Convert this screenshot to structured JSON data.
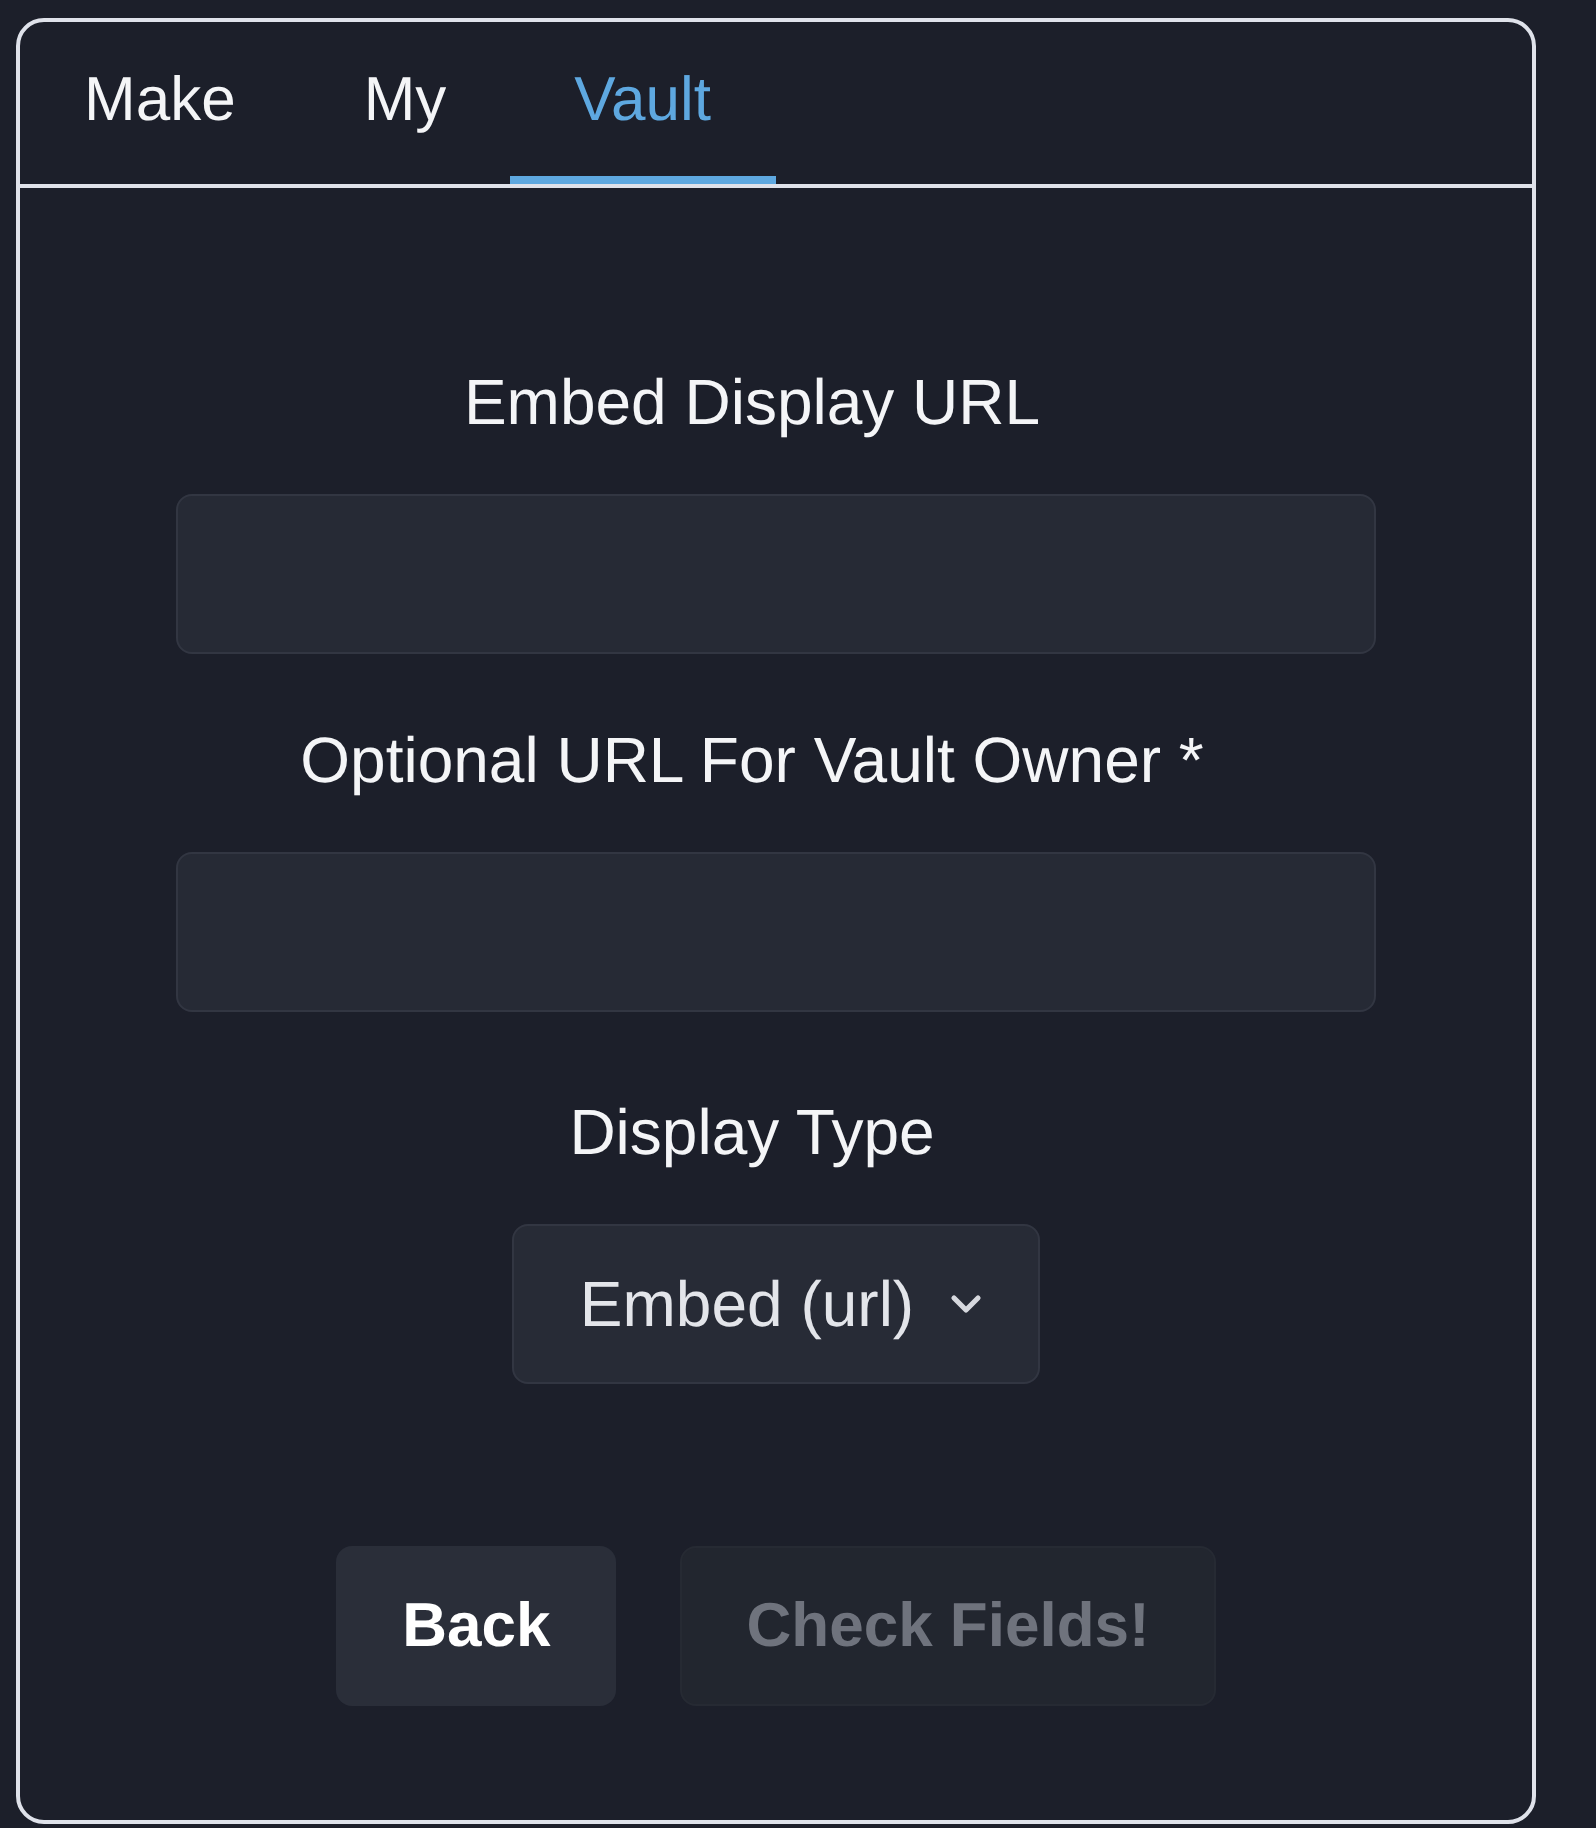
{
  "tabs": [
    {
      "label": "Make",
      "selected": false
    },
    {
      "label": "My",
      "selected": false
    },
    {
      "label": "Vault",
      "selected": true
    }
  ],
  "form": {
    "fields": [
      {
        "label": "Embed Display URL"
      },
      {
        "label": "Optional URL For Vault Owner *"
      }
    ],
    "display_type": {
      "label": "Display Type",
      "value": "Embed (url)"
    },
    "buttons": [
      {
        "label": "Back",
        "disabled": false
      },
      {
        "label": "Check Fields!",
        "disabled": true
      }
    ]
  }
}
